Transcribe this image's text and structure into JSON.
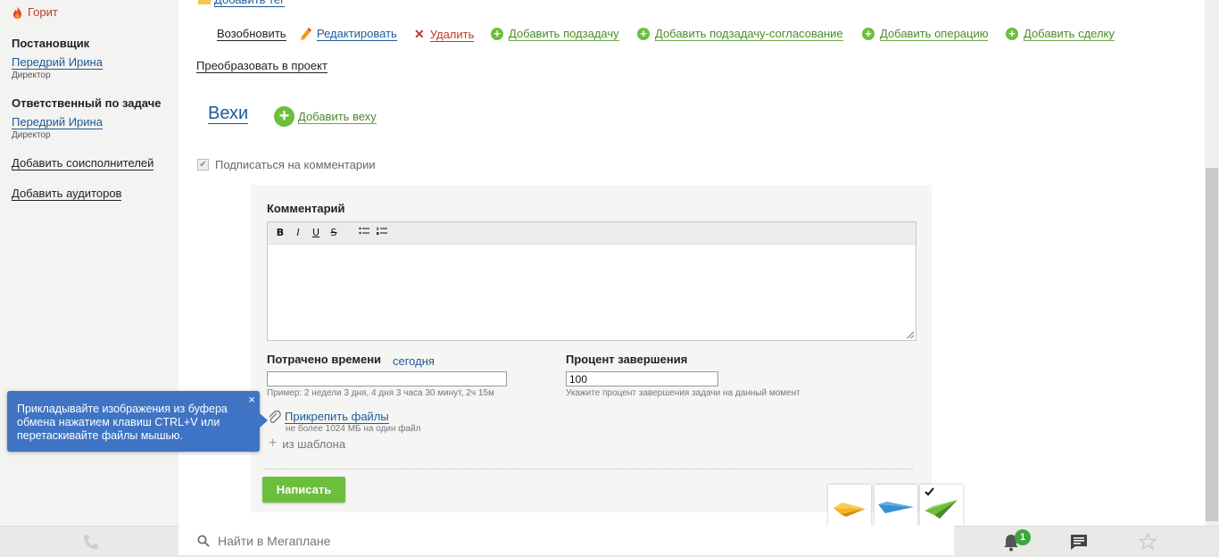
{
  "sidebar": {
    "status_label": "Горит",
    "setter_heading": "Постановщик",
    "setter_name": "Передрий Ирина",
    "setter_role": "Директор",
    "responsible_heading": "Ответственный по задаче",
    "responsible_name": "Передрий Ирина",
    "responsible_role": "Директор",
    "add_coexecutors": "Добавить соисполнителей",
    "add_auditors": "Добавить аудиторов"
  },
  "top": {
    "add_tag": "Добавить тег"
  },
  "toolbar": {
    "resume": "Возобновить",
    "edit": "Редактировать",
    "delete": "Удалить",
    "add_subtask": "Добавить подзадачу",
    "add_approval_subtask": "Добавить подзадачу-согласование",
    "add_operation": "Добавить операцию",
    "add_deal": "Добавить сделку",
    "convert_project": "Преобразовать в проект"
  },
  "milestones": {
    "title": "Вехи",
    "add_label": "Добавить веху"
  },
  "subscribe": {
    "label": "Подписаться на комментарии",
    "checked": true
  },
  "comment": {
    "label": "Комментарий",
    "editor_buttons": [
      "B",
      "I",
      "U",
      "S"
    ],
    "value": "",
    "time_label": "Потрачено времени",
    "today_link": "сегодня",
    "time_value": "",
    "time_hint": "Пример: 2 недели 3 дня, 4 дня 3 часа 30 минут, 2ч 15м",
    "percent_label": "Процент завершения",
    "percent_value": "100",
    "percent_hint": "Укажите процент завершения задачи на данный момент",
    "attach_label": "Прикрепить файлы",
    "attach_hint": "не более 1024 МБ на один файл",
    "from_template": "из шаблона",
    "submit_label": "Написать"
  },
  "tooltip": {
    "text": "Прикладывайте изображения из буфера обмена нажатием клавиш CTRL+V или перетаскивайте файлы мышью.",
    "close": "×"
  },
  "bottombar": {
    "search_placeholder": "Найти в Мегаплане",
    "notification_count": "1"
  },
  "colors": {
    "accent_green": "#6cbf3c",
    "link_blue": "#1e5a96",
    "danger_red": "#c0392b",
    "tooltip_blue": "#3f74c4"
  },
  "icons": {
    "status": "flame-icon",
    "edit": "pencil-icon",
    "delete": "cross-icon",
    "add": "plus-circle-icon",
    "attach": "paperclip-icon",
    "phone": "phone-icon",
    "search": "search-icon",
    "notifications": "bell-icon",
    "chat": "chat-icon",
    "favorites": "star-icon",
    "planes": [
      "plane-yellow-icon",
      "plane-blue-icon",
      "plane-green-icon"
    ]
  }
}
